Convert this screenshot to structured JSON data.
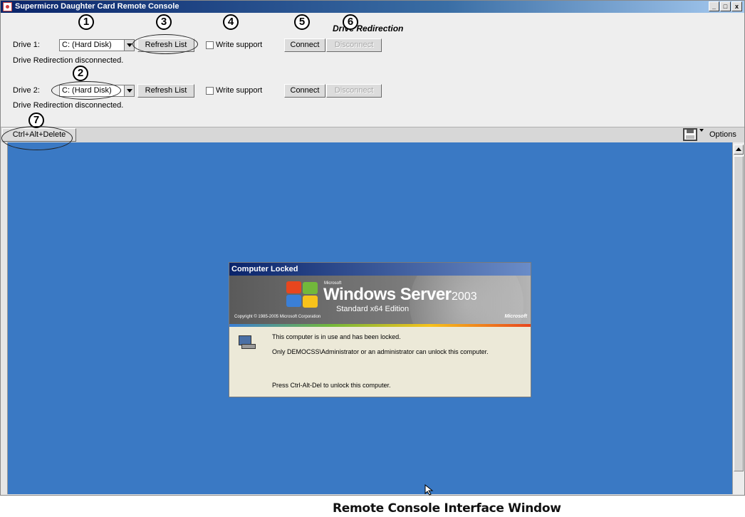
{
  "window": {
    "title": "Supermicro Daughter Card Remote Console",
    "controls": [
      "_",
      "□",
      "x"
    ]
  },
  "drive_redirection": {
    "section_title": "Drive Redirection",
    "drives": [
      {
        "label": "Drive 1:",
        "selected": "C: (Hard Disk)",
        "refresh_label": "Refresh List",
        "write_support_label": "Write support",
        "write_support_checked": false,
        "connect_label": "Connect",
        "disconnect_label": "Disconnect",
        "status": "Drive Redirection disconnected."
      },
      {
        "label": "Drive 2:",
        "selected": "C: (Hard Disk)",
        "refresh_label": "Refresh List",
        "write_support_label": "Write support",
        "write_support_checked": false,
        "connect_label": "Connect",
        "disconnect_label": "Disconnect",
        "status": "Drive Redirection disconnected."
      }
    ]
  },
  "callouts": [
    "1",
    "2",
    "3",
    "4",
    "5",
    "6",
    "7"
  ],
  "toolbar": {
    "ctrl_alt_delete_label": "Ctrl+Alt+Delete",
    "options_label": "Options",
    "options_icon": "floppy-disk-icon"
  },
  "remote_screen": {
    "background_color": "#3a79c4",
    "dialog": {
      "title": "Computer Locked",
      "brand_small": "Microsoft",
      "brand_name": "Windows Server",
      "brand_year": "2003",
      "edition": "Standard x64 Edition",
      "copyright": "Copyright © 1985-2005 Microsoft Corporation",
      "brand_right": "Microsoft",
      "line1": "This computer is in use and has been locked.",
      "line2": "Only DEMOCSS\\Administrator or an administrator can unlock this computer.",
      "line3": "Press Ctrl-Alt-Del to unlock this computer."
    }
  },
  "caption": "Remote Console Interface Window"
}
